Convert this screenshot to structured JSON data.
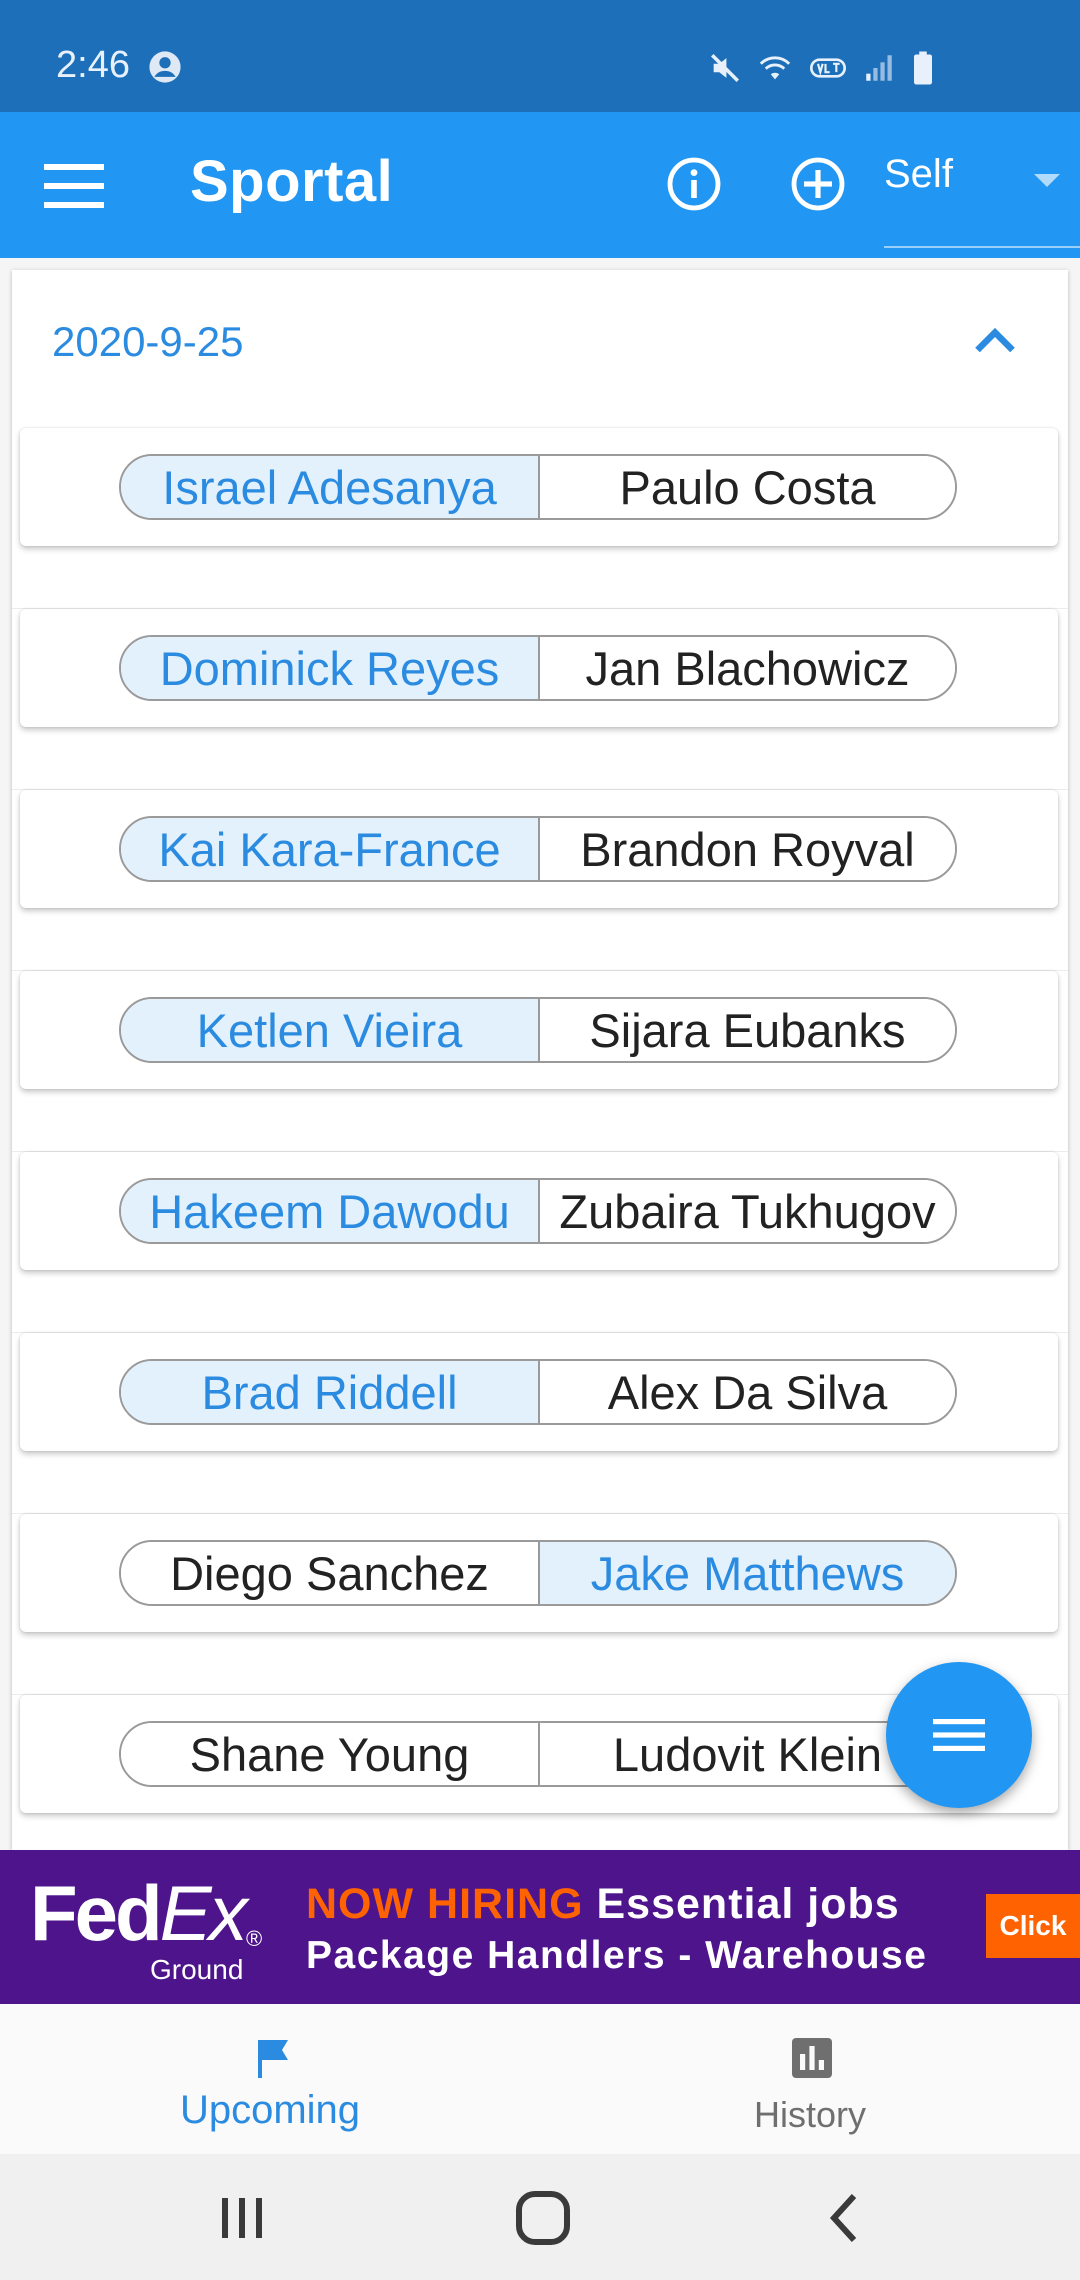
{
  "status_bar": {
    "time": "2:46",
    "icons": [
      "account-circle-icon",
      "mute-icon",
      "wifi-icon",
      "volte-icon",
      "signal-icon",
      "battery-icon"
    ]
  },
  "app_bar": {
    "title": "Sportal",
    "icons": [
      "hamburger-menu-icon",
      "info-icon",
      "add-circle-icon"
    ],
    "select_value": "Self",
    "background": "#2196f3"
  },
  "event": {
    "date": "2020-9-25",
    "expanded": true,
    "fights": [
      {
        "fighters": [
          "Israel Adesanya",
          "Paulo Costa"
        ],
        "picked": 0
      },
      {
        "fighters": [
          "Dominick Reyes",
          "Jan Blachowicz"
        ],
        "picked": 0
      },
      {
        "fighters": [
          "Kai Kara-France",
          "Brandon Royval"
        ],
        "picked": 0
      },
      {
        "fighters": [
          "Ketlen Vieira",
          "Sijara Eubanks"
        ],
        "picked": 0
      },
      {
        "fighters": [
          "Hakeem Dawodu",
          "Zubaira Tukhugov"
        ],
        "picked": 0
      },
      {
        "fighters": [
          "Brad Riddell",
          "Alex Da Silva"
        ],
        "picked": 0
      },
      {
        "fighters": [
          "Diego Sanchez",
          "Jake Matthews"
        ],
        "picked": 1
      },
      {
        "fighters": [
          "Shane Young",
          "Ludovit Klein"
        ],
        "picked": null
      }
    ]
  },
  "fab": {
    "icon": "menu-lines-icon"
  },
  "ad": {
    "brand": "Fed",
    "brand_ex": "Ex",
    "brand_sub": "Ground",
    "brand_reg": "®",
    "headline_highlight": "NOW HIRING",
    "headline_rest": "Essential jobs",
    "subline": "Package Handlers - Warehouse",
    "cta": "Click",
    "colors": {
      "background": "#4d148c",
      "accent": "#ff6200"
    }
  },
  "bottom_nav": {
    "items": [
      {
        "label": "Upcoming",
        "icon": "flag-icon",
        "active": true
      },
      {
        "label": "History",
        "icon": "bar-chart-icon",
        "active": false
      }
    ]
  },
  "system_nav": {
    "icons": [
      "recent-apps-icon",
      "home-icon",
      "back-icon"
    ]
  },
  "colors": {
    "accent": "#2b8be0",
    "picked_bg": "#e3f1fc"
  }
}
